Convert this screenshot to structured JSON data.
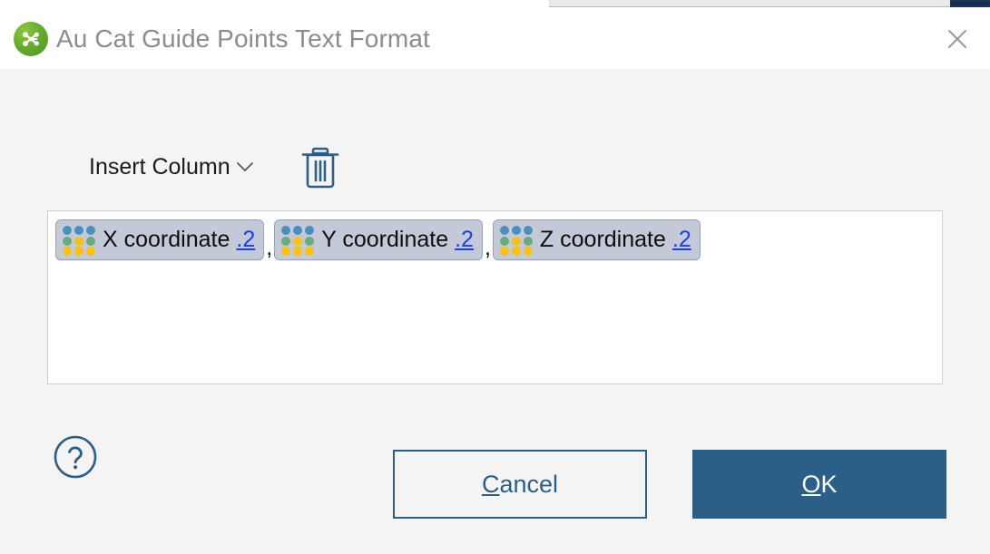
{
  "window": {
    "title": "Au Cat Guide Points Text Format",
    "app_icon": "molecule-node-icon",
    "close_icon": "close-icon",
    "title_color": "#8c8c8c",
    "accent_color": "#2b5f87"
  },
  "toolbar": {
    "insert_column_label": "Insert Column",
    "chevron_icon": "chevron-down-icon",
    "delete_icon": "trash-icon"
  },
  "format_editor": {
    "separator": ",",
    "tokens": [
      {
        "label": "X coordinate",
        "suffix": ".2",
        "icon": "dot-grid-icon"
      },
      {
        "label": "Y coordinate",
        "suffix": ".2",
        "icon": "dot-grid-icon"
      },
      {
        "label": "Z coordinate",
        "suffix": ".2",
        "icon": "dot-grid-icon"
      }
    ]
  },
  "footer": {
    "help_icon": "question-mark-circle-icon",
    "cancel": {
      "accel": "C",
      "rest": "ancel"
    },
    "ok": {
      "accel": "O",
      "rest": "K"
    }
  },
  "colors": {
    "dot_blue": "#4a8fc0",
    "dot_green": "#6aab7e",
    "dot_yellow": "#f6c217",
    "chip_bg": "#c3c9d6",
    "chip_border": "#9aa3b5",
    "suffix_link": "#1a3ee8",
    "dialog_bg": "#f4f4f4",
    "titlebar_bg": "#ffffff"
  }
}
